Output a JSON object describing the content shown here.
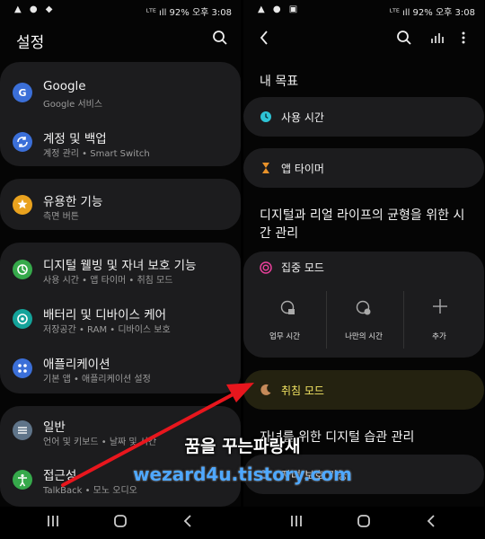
{
  "left": {
    "status": {
      "left": "▲ ● ◆",
      "right": "ᴸᵀᴱ ıll 92% 오후 3:08"
    },
    "title": "설정",
    "groups": [
      {
        "items": [
          {
            "title": "Google",
            "subtitle": "Google 서비스",
            "icon": "google-icon",
            "color": "#3b6fd8"
          },
          {
            "title": "계정 및 백업",
            "subtitle": "계정 관리 • Smart Switch",
            "icon": "sync-icon",
            "color": "#3b6fd8"
          }
        ]
      },
      {
        "items": [
          {
            "title": "유용한 기능",
            "subtitle": "측면 버튼",
            "icon": "star-gear-icon",
            "color": "#e9a21e"
          }
        ]
      },
      {
        "items": [
          {
            "title": "디지털 웰빙 및 자녀 보호 기능",
            "subtitle": "사용 시간 • 앱 타이머 • 취침 모드",
            "icon": "wellbeing-icon",
            "color": "#36a94b"
          },
          {
            "title": "배터리 및 디바이스 케어",
            "subtitle": "저장공간 • RAM • 디바이스 보호",
            "icon": "device-care-icon",
            "color": "#14a39a"
          },
          {
            "title": "애플리케이션",
            "subtitle": "기본 앱 • 애플리케이션 설정",
            "icon": "apps-icon",
            "color": "#3b6fd8"
          }
        ]
      },
      {
        "items": [
          {
            "title": "일반",
            "subtitle": "언어 및 키보드 • 날짜 및 시간",
            "icon": "sliders-icon",
            "color": "#5f7489"
          },
          {
            "title": "접근성",
            "subtitle": "TalkBack • 모노 오디오",
            "icon": "accessibility-icon",
            "color": "#36a94b"
          }
        ]
      }
    ]
  },
  "right": {
    "status": {
      "left": "▲ ● ▣",
      "right": "ᴸᵀᴱ ıll 92% 오후 3:08"
    },
    "section_goals": "내 목표",
    "usage_time": "사용 시간",
    "app_timer": "앱 타이머",
    "section_balance": "디지털과 리얼 라이프의 균형을 위한 시간 관리",
    "focus_mode": "집중 모드",
    "tiles": [
      "업무 시간",
      "나만의 시간",
      "추가"
    ],
    "sleep_mode": "취침 모드",
    "section_kids": "자녀를 위한 디지털 습관 관리",
    "parental": "자녀 보호 기능"
  },
  "watermark": {
    "line1": "꿈을 꾸는파랑새",
    "line2": "wezard4u.tistory.com"
  },
  "colors": {
    "accent_yellow": "#f5e663",
    "arrow": "#e8161d"
  }
}
